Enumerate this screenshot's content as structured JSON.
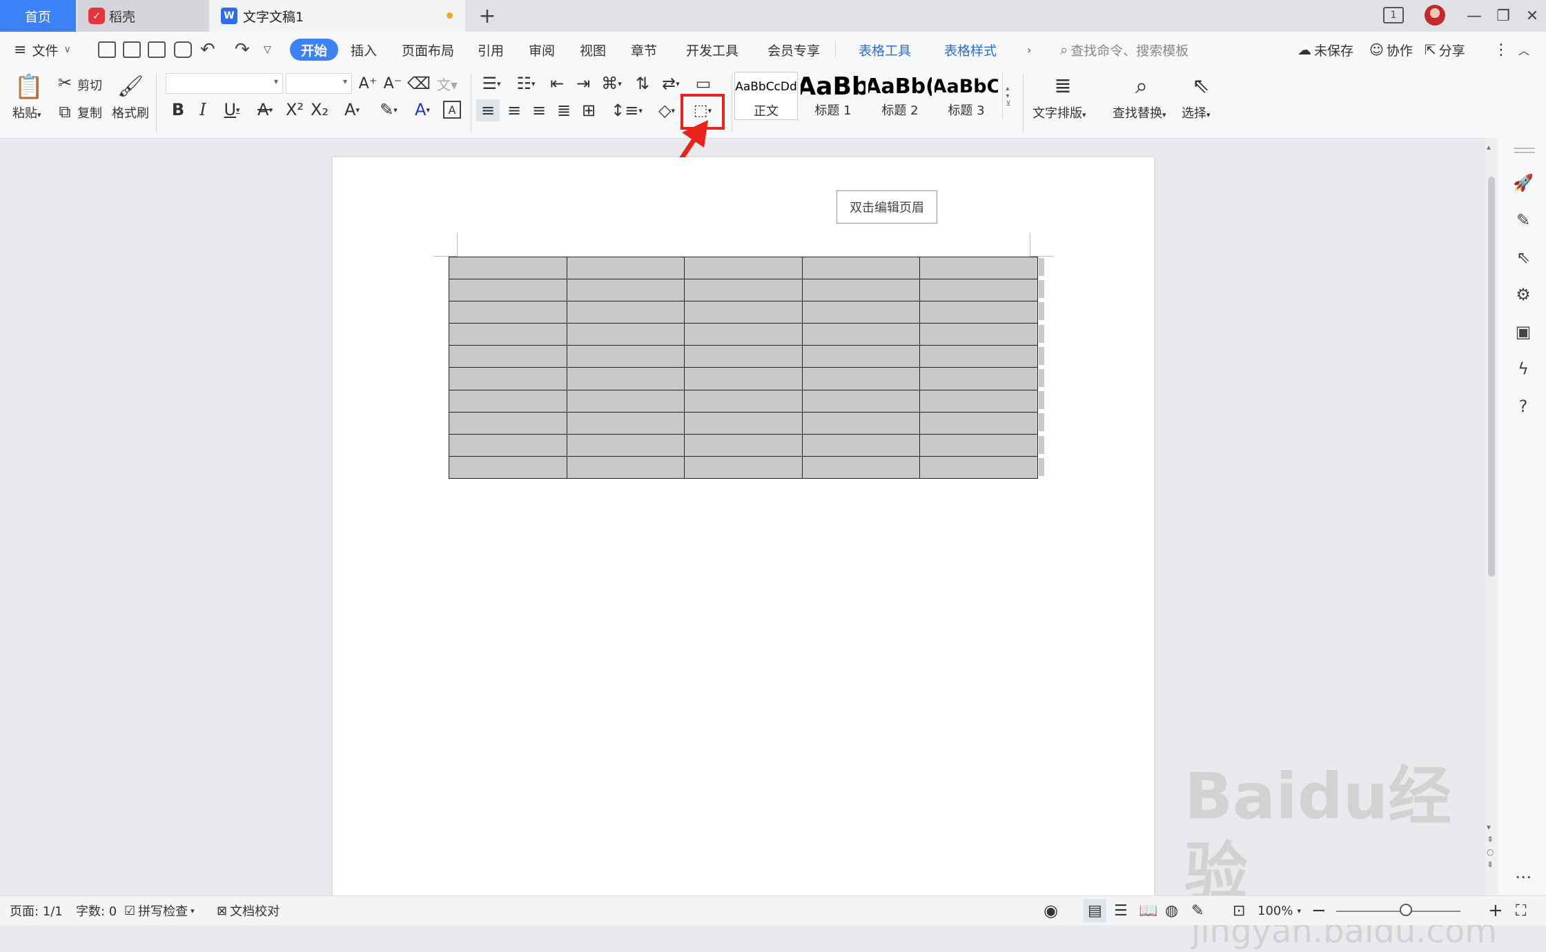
{
  "tabs": {
    "home": "首页",
    "daoke": "稻壳",
    "doc": "文字文稿1",
    "new_tab": "+"
  },
  "window": {
    "badge": "1"
  },
  "menu": {
    "file": "文件",
    "items": [
      "开始",
      "插入",
      "页面布局",
      "引用",
      "审阅",
      "视图",
      "章节",
      "开发工具",
      "会员专享"
    ],
    "table_tools": "表格工具",
    "table_style": "表格样式",
    "search_placeholder": "查找命令、搜索模板",
    "unsaved": "未保存",
    "collab": "协作",
    "share": "分享"
  },
  "ribbon": {
    "paste": "粘贴",
    "cut": "剪切",
    "copy": "复制",
    "format_painter": "格式刷",
    "styles": [
      {
        "preview": "AaBbCcDd",
        "name": "正文"
      },
      {
        "preview": "AaBb",
        "name": "标题 1"
      },
      {
        "preview": "AaBb(",
        "name": "标题 2"
      },
      {
        "preview": "AaBbC",
        "name": "标题 3"
      }
    ],
    "text_layout": "文字排版",
    "find_replace": "查找替换",
    "select": "选择"
  },
  "document": {
    "header_hint": "双击编辑页眉",
    "table": {
      "rows": 10,
      "cols": 5
    }
  },
  "status": {
    "page": "页面: 1/1",
    "words": "字数: 0",
    "spell": "拼写检查",
    "proof": "文档校对",
    "zoom": "100%"
  },
  "watermark": {
    "brand": "Baidu经验",
    "url": "jingyan.baidu.com"
  },
  "colors": {
    "accent": "#3c82f6",
    "highlight": "#e8231a",
    "table_cell": "#c8c8c8"
  }
}
